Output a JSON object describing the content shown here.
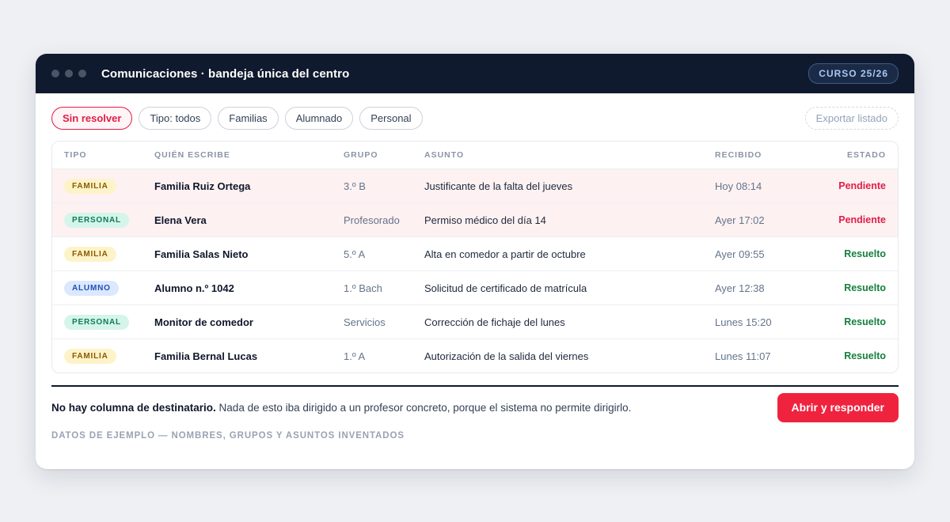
{
  "window": {
    "title": "Comunicaciones · bandeja única del centro",
    "course_badge": "CURSO 25/26"
  },
  "filters": {
    "chips": [
      "Sin resolver",
      "Tipo: todos",
      "Familias",
      "Alumnado",
      "Personal"
    ],
    "active_index": 0,
    "export_label": "Exportar listado"
  },
  "table": {
    "columns": [
      "TIPO",
      "QUIÉN ESCRIBE",
      "GRUPO",
      "ASUNTO",
      "RECIBIDO",
      "ESTADO"
    ],
    "rows": [
      {
        "type": "FAMILIA",
        "type_kind": "familia",
        "who": "Familia Ruiz Ortega",
        "group": "3.º B",
        "subject": "Justificante de la falta del jueves",
        "received": "Hoy 08:14",
        "state": "Pendiente",
        "state_kind": "pending"
      },
      {
        "type": "PERSONAL",
        "type_kind": "personal",
        "who": "Elena Vera",
        "group": "Profesorado",
        "subject": "Permiso médico del día 14",
        "received": "Ayer 17:02",
        "state": "Pendiente",
        "state_kind": "pending"
      },
      {
        "type": "FAMILIA",
        "type_kind": "familia",
        "who": "Familia Salas Nieto",
        "group": "5.º A",
        "subject": "Alta en comedor a partir de octubre",
        "received": "Ayer 09:55",
        "state": "Resuelto",
        "state_kind": "resolved"
      },
      {
        "type": "ALUMNO",
        "type_kind": "alumno",
        "who": "Alumno n.º 1042",
        "group": "1.º Bach",
        "subject": "Solicitud de certificado de matrícula",
        "received": "Ayer 12:38",
        "state": "Resuelto",
        "state_kind": "resolved"
      },
      {
        "type": "PERSONAL",
        "type_kind": "personal",
        "who": "Monitor de comedor",
        "group": "Servicios",
        "subject": "Corrección de fichaje del lunes",
        "received": "Lunes 15:20",
        "state": "Resuelto",
        "state_kind": "resolved"
      },
      {
        "type": "FAMILIA",
        "type_kind": "familia",
        "who": "Familia Bernal Lucas",
        "group": "1.º A",
        "subject": "Autorización de la salida del viernes",
        "received": "Lunes 11:07",
        "state": "Resuelto",
        "state_kind": "resolved"
      }
    ]
  },
  "footer": {
    "note_bold": "No hay columna de destinatario.",
    "note_text": " Nada de esto iba dirigido a un profesor concreto, porque el sistema no permite dirigirlo.",
    "reply_button": "Abrir y responder",
    "disclaimer": "DATOS DE EJEMPLO — NOMBRES, GRUPOS Y ASUNTOS INVENTADOS"
  },
  "colors": {
    "titlebar": "#101a2e",
    "accent": "#f0233f",
    "pending": "#e11d48",
    "resolved": "#15803d"
  }
}
